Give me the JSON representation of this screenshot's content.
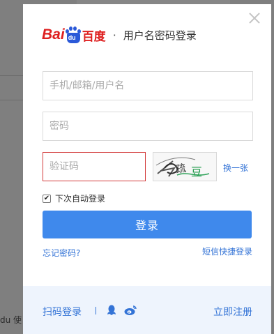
{
  "background": {
    "partial_text": "du 使"
  },
  "dialog": {
    "logo": {
      "bai": "Bai",
      "du_paw": "du",
      "cn": "百度"
    },
    "separator": "·",
    "title": "用户名密码登录",
    "username": {
      "placeholder": "手机/邮箱/用户名",
      "value": ""
    },
    "password": {
      "placeholder": "密码",
      "value": ""
    },
    "captcha": {
      "placeholder": "验证码",
      "value": "",
      "refresh_label": "换一张"
    },
    "remember_label": "下次自动登录",
    "remember_checked": true,
    "checkmark": "✔",
    "login_label": "登录",
    "forgot_label": "忘记密码?",
    "sms_login_label": "短信快捷登录",
    "footer": {
      "qr_login_label": "扫码登录",
      "register_label": "立即注册",
      "icons": [
        "qq-icon",
        "weibo-icon"
      ]
    }
  },
  "colors": {
    "accent": "#3f89ec",
    "link": "#3373d6",
    "brand_red": "#de1f1f",
    "brand_blue": "#2b59d8",
    "error_border": "#d33a3a"
  }
}
